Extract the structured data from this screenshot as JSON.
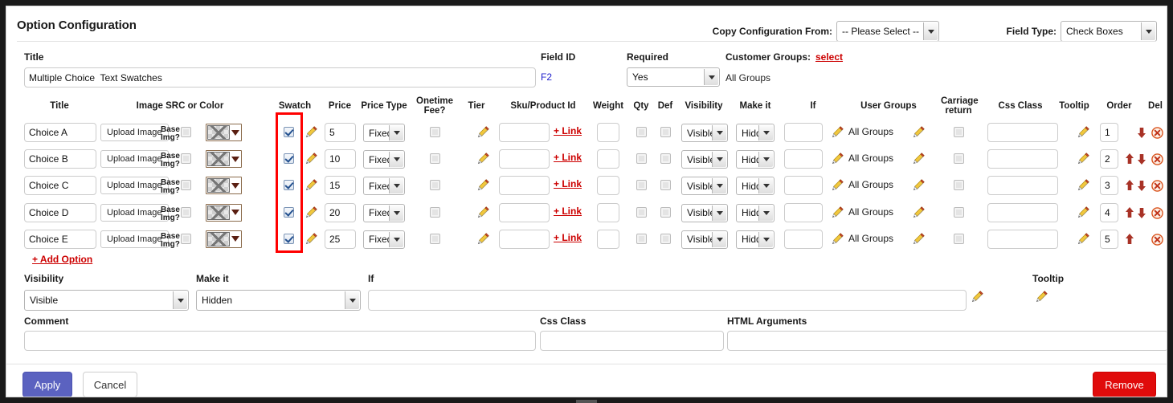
{
  "header": {
    "title": "Option Configuration",
    "copy_config_label": "Copy Configuration From:",
    "copy_config_value": "-- Please Select --",
    "field_type_label": "Field Type:",
    "field_type_value": "Check Boxes"
  },
  "top_form": {
    "title_label": "Title",
    "title_value": "Multiple Choice  Text Swatches",
    "field_id_label": "Field ID",
    "field_id_value": "F2",
    "required_label": "Required",
    "required_value": "Yes",
    "customer_groups_label": "Customer Groups:",
    "customer_groups_link": "select",
    "customer_groups_value": "All Groups"
  },
  "table": {
    "headers": [
      "Title",
      "Image SRC or Color",
      "Swatch",
      "Price",
      "Price Type",
      "Onetime Fee?",
      "Tier",
      "Sku/Product Id",
      "Weight",
      "Qty",
      "Def",
      "Visibility",
      "Make it",
      "If",
      "User Groups",
      "Carriage return",
      "Css Class",
      "Tooltip",
      "Order",
      "Del"
    ],
    "upload_label": "Upload Image",
    "base_img_label_line1": "Base",
    "base_img_label_line2": "Img?",
    "link_label": "+ Link",
    "user_groups_value": "All Groups",
    "rows": [
      {
        "title": "Choice A",
        "swatch_checked": true,
        "price": "5",
        "price_type": "Fixed",
        "onetime_fee": false,
        "sku": "",
        "weight": "",
        "qty": false,
        "def": false,
        "visibility": "Visible",
        "make_it": "Hidd",
        "if": "",
        "carriage_return": false,
        "css_class": "",
        "order": "1",
        "move_up": false,
        "move_down": true
      },
      {
        "title": "Choice B",
        "swatch_checked": true,
        "price": "10",
        "price_type": "Fixed",
        "onetime_fee": false,
        "sku": "",
        "weight": "",
        "qty": false,
        "def": false,
        "visibility": "Visible",
        "make_it": "Hidd",
        "if": "",
        "carriage_return": false,
        "css_class": "",
        "order": "2",
        "move_up": true,
        "move_down": true
      },
      {
        "title": "Choice C",
        "swatch_checked": true,
        "price": "15",
        "price_type": "Fixed",
        "onetime_fee": false,
        "sku": "",
        "weight": "",
        "qty": false,
        "def": false,
        "visibility": "Visible",
        "make_it": "Hidd",
        "if": "",
        "carriage_return": false,
        "css_class": "",
        "order": "3",
        "move_up": true,
        "move_down": true
      },
      {
        "title": "Choice D",
        "swatch_checked": true,
        "price": "20",
        "price_type": "Fixed",
        "onetime_fee": false,
        "sku": "",
        "weight": "",
        "qty": false,
        "def": false,
        "visibility": "Visible",
        "make_it": "Hidd",
        "if": "",
        "carriage_return": false,
        "css_class": "",
        "order": "4",
        "move_up": true,
        "move_down": true
      },
      {
        "title": "Choice E",
        "swatch_checked": true,
        "price": "25",
        "price_type": "Fixed",
        "onetime_fee": false,
        "sku": "",
        "weight": "",
        "qty": false,
        "def": false,
        "visibility": "Visible",
        "make_it": "Hidd",
        "if": "",
        "carriage_return": false,
        "css_class": "",
        "order": "5",
        "move_up": true,
        "move_down": false
      }
    ]
  },
  "lower_form": {
    "add_option_link": "+ Add Option",
    "visibility_label": "Visibility",
    "visibility_value": "Visible",
    "make_it_label": "Make it",
    "make_it_value": "Hidden",
    "if_label": "If",
    "if_value": "",
    "tooltip_label": "Tooltip",
    "comment_label": "Comment",
    "comment_value": "",
    "css_class_label": "Css Class",
    "css_class_value": "",
    "html_arguments_label": "HTML Arguments",
    "html_arguments_value": ""
  },
  "footer": {
    "apply_label": "Apply",
    "cancel_label": "Cancel",
    "remove_label": "Remove"
  },
  "colors": {
    "link_red": "#cc0000",
    "highlight_red": "#ff0000",
    "apply_blue": "#5b62c0",
    "remove_red": "#e00b0b",
    "field_id_blue": "#2222cc"
  }
}
